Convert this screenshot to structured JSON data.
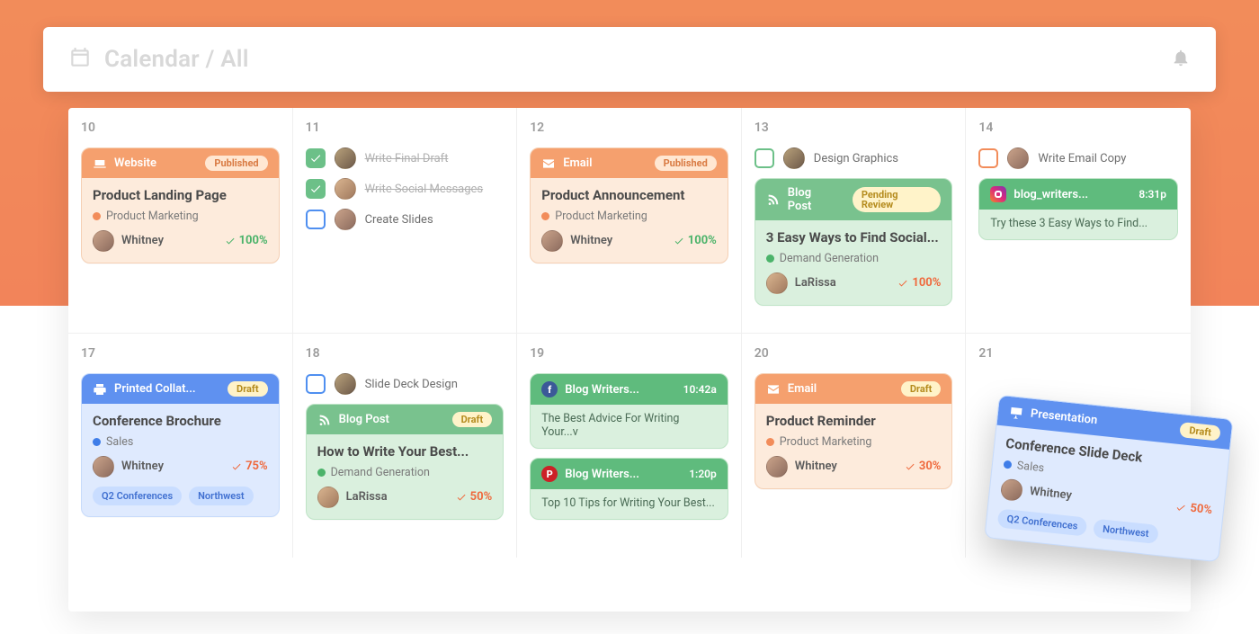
{
  "header": {
    "title": "Calendar / All"
  },
  "days_row1": [
    "10",
    "11",
    "12",
    "13",
    "14"
  ],
  "days_row2": [
    "17",
    "18",
    "19",
    "20",
    "21"
  ],
  "pills": {
    "published": "Published",
    "pending": "Pending Review",
    "draft": "Draft"
  },
  "d10": {
    "type": "Website",
    "status": "Published",
    "title": "Product Landing Page",
    "category": "Product Marketing",
    "assignee": "Whitney",
    "progress": "100%"
  },
  "d11_tasks": [
    {
      "label": "Write Final Draft",
      "done": true
    },
    {
      "label": "Write Social Messages",
      "done": true
    },
    {
      "label": "Create Slides",
      "done": false
    }
  ],
  "d12": {
    "type": "Email",
    "status": "Published",
    "title": "Product Announcement",
    "category": "Product Marketing",
    "assignee": "Whitney",
    "progress": "100%"
  },
  "d13_task": {
    "label": "Design Graphics"
  },
  "d13_card": {
    "type": "Blog Post",
    "status": "Pending Review",
    "title": "3 Easy Ways to Find Social...",
    "category": "Demand Generation",
    "assignee": "LaRissa",
    "progress": "100%"
  },
  "d14_task": {
    "label": "Write Email Copy"
  },
  "d14_card": {
    "channel": "blog_writers...",
    "time": "8:31p",
    "line": "Try these 3 Easy Ways to Find..."
  },
  "d17": {
    "type": "Printed Collat...",
    "status": "Draft",
    "title": "Conference Brochure",
    "category": "Sales",
    "assignee": "Whitney",
    "progress": "75%",
    "tags": [
      "Q2 Conferences",
      "Northwest"
    ]
  },
  "d18_task": {
    "label": "Slide Deck Design"
  },
  "d18_card": {
    "type": "Blog Post",
    "status": "Draft",
    "title": "How to Write Your Best...",
    "category": "Demand Generation",
    "assignee": "LaRissa",
    "progress": "50%"
  },
  "d19_fb": {
    "channel": "Blog Writers...",
    "time": "10:42a",
    "line": "The Best Advice For Writing Your...v"
  },
  "d19_pin": {
    "channel": "Blog Writers...",
    "time": "1:20p",
    "line": "Top 10 Tips for Writing Your Best..."
  },
  "d20": {
    "type": "Email",
    "status": "Draft",
    "title": "Product Reminder",
    "category": "Product Marketing",
    "assignee": "Whitney",
    "progress": "30%"
  },
  "floating": {
    "type": "Presentation",
    "status": "Draft",
    "title": "Conference Slide Deck",
    "category": "Sales",
    "assignee": "Whitney",
    "progress": "50%",
    "tags": [
      "Q2 Conferences",
      "Northwest"
    ]
  }
}
